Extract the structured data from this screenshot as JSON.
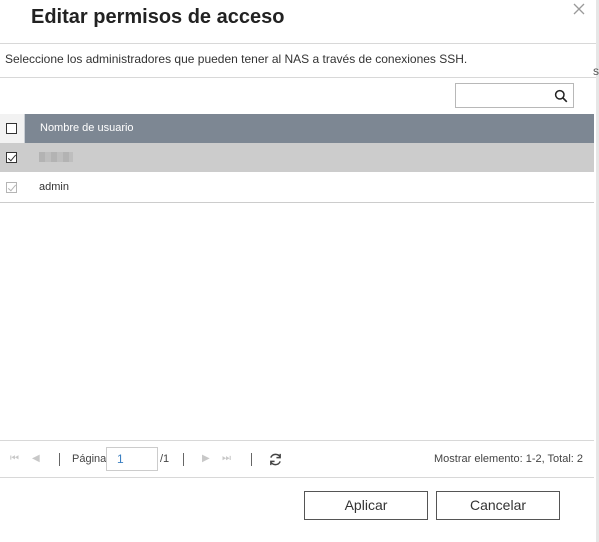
{
  "dialog": {
    "title": "Editar permisos de acceso",
    "description": "Seleccione los administradores que pueden tener al NAS a través de conexiones SSH.",
    "stray_char": "s"
  },
  "search": {
    "value": "",
    "placeholder": ""
  },
  "grid": {
    "column_header": "Nombre de usuario",
    "rows": [
      {
        "name": "",
        "checked": true,
        "disabled": false,
        "selected": true
      },
      {
        "name": "admin",
        "checked": true,
        "disabled": true,
        "selected": false
      }
    ]
  },
  "pager": {
    "page_label": "Página",
    "page_value": "1",
    "total_pages": "/1",
    "info": "Mostrar elemento: 1-2, Total: 2"
  },
  "buttons": {
    "apply": "Aplicar",
    "cancel": "Cancelar"
  },
  "colors": {
    "header_bg": "#7d8793",
    "selected_row_bg": "#cccccc",
    "link_blue": "#3a7fc1"
  }
}
